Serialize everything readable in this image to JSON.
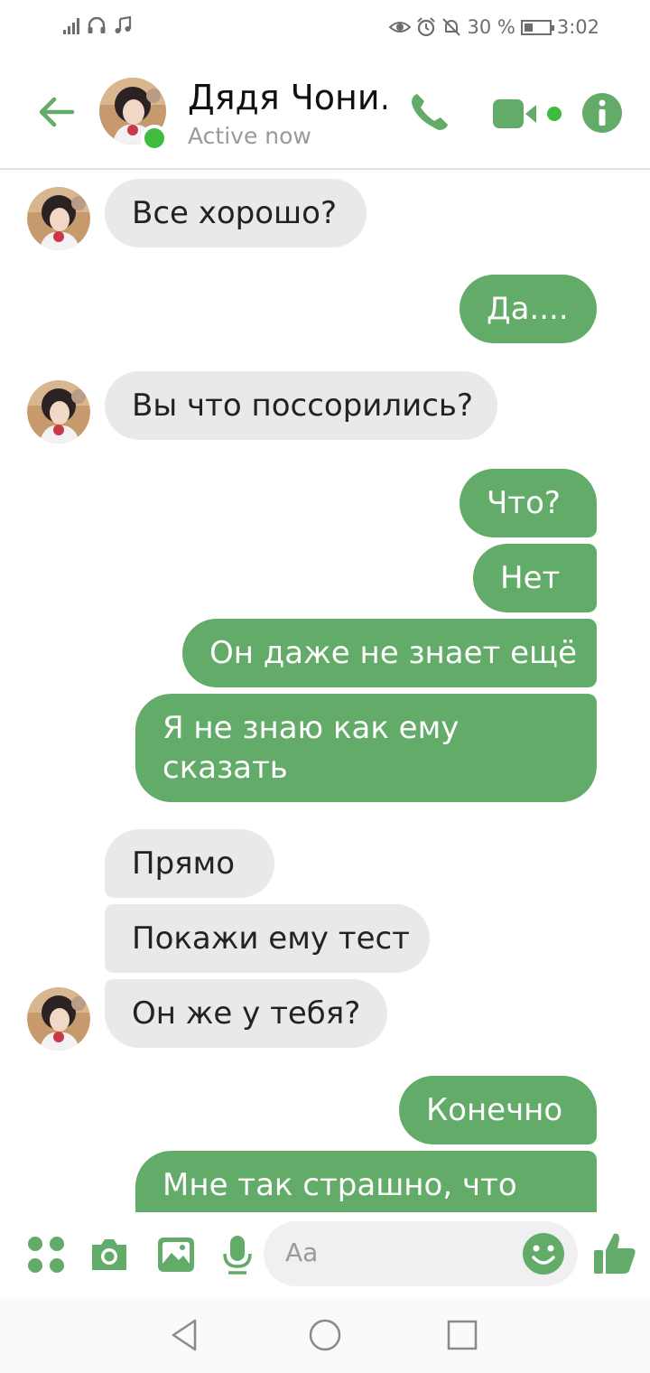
{
  "status_bar": {
    "battery_percent": "30 %",
    "time": "3:02"
  },
  "header": {
    "contact_name": "Дядя Чони...",
    "status": "Active now"
  },
  "messages": [
    {
      "side": "in",
      "text": "Все хорошо?"
    },
    {
      "side": "out",
      "text": "Да...."
    },
    {
      "side": "in",
      "text": "Вы что поссорились?"
    },
    {
      "side": "out",
      "text": "Что?"
    },
    {
      "side": "out",
      "text": "Нет"
    },
    {
      "side": "out",
      "text": "Он даже не знает ещё"
    },
    {
      "side": "out",
      "text": "Я не знаю как ему сказать"
    },
    {
      "side": "in",
      "text": "Прямо"
    },
    {
      "side": "in",
      "text": "Покажи ему тест"
    },
    {
      "side": "in",
      "text": "Он же у тебя?"
    },
    {
      "side": "out",
      "text": "Конечно"
    },
    {
      "side": "out",
      "text": "Мне так страшно, что"
    }
  ],
  "composer": {
    "placeholder": "Aa"
  },
  "colors": {
    "accent": "#63ab69",
    "incoming_bubble": "#e9e9eb",
    "online": "#3fbb3f"
  },
  "icons": [
    "back-arrow-icon",
    "phone-icon",
    "video-camera-icon",
    "info-icon",
    "apps-icon",
    "camera-icon",
    "gallery-icon",
    "microphone-icon",
    "emoji-icon",
    "thumbs-up-icon",
    "nav-back-icon",
    "nav-home-icon",
    "nav-recents-icon"
  ]
}
